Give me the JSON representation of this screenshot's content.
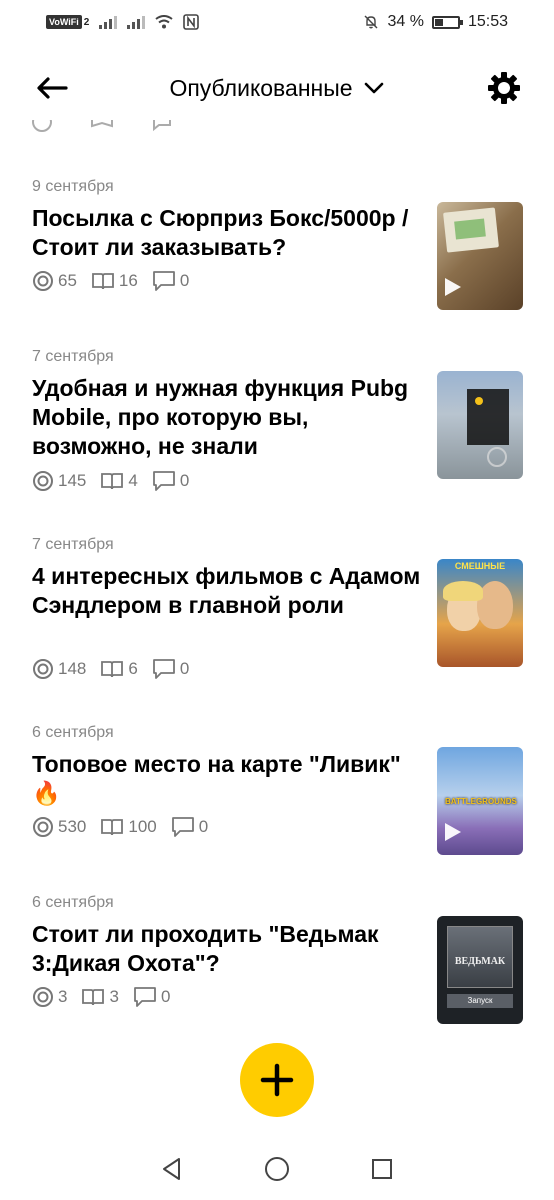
{
  "status_bar": {
    "vowifi": "VoWiFi",
    "sim_index": "2",
    "battery_percent": "34 %",
    "battery_level": 0.34,
    "time": "15:53"
  },
  "header": {
    "title": "Опубликованные",
    "back_icon": "arrow-left-icon",
    "dropdown_icon": "chevron-down-icon",
    "settings_icon": "gear-icon"
  },
  "articles": [
    {
      "date": "9 сентября",
      "title": "Посылка с Сюрприз Бокс/5000р / Стоит ли заказывать?",
      "views": "65",
      "reads": "16",
      "comments": "0",
      "has_video": true
    },
    {
      "date": "7 сентября",
      "title": "Удобная и нужная функция Pubg Mobile, про которую вы, возможно, не знали",
      "views": "145",
      "reads": "4",
      "comments": "0",
      "has_video": false
    },
    {
      "date": "7 сентября",
      "title": "4 интересных фильмов с Адамом Сэндлером в главной роли",
      "views": "148",
      "reads": "6",
      "comments": "0",
      "has_video": false,
      "thumb_caption": "СМЕШНЫЕ"
    },
    {
      "date": "6 сентября",
      "title": "Топовое место на карте \"Ливик\" 🔥",
      "views": "530",
      "reads": "100",
      "comments": "0",
      "has_video": true,
      "thumb_caption": "BATTLEGROUNDS"
    },
    {
      "date": "6 сентября",
      "title": "Стоит ли проходить \"Ведьмак 3:Дикая Охота\"?",
      "views": "3",
      "reads": "3",
      "comments": "0",
      "has_video": false,
      "thumb_caption": "ВЕДЬМАК",
      "thumb_caption_2": "Запуск"
    }
  ],
  "fab": {
    "icon": "plus-icon"
  },
  "navbar": {
    "back_icon": "triangle-back-icon",
    "home_icon": "circle-home-icon",
    "recents_icon": "square-recents-icon"
  }
}
